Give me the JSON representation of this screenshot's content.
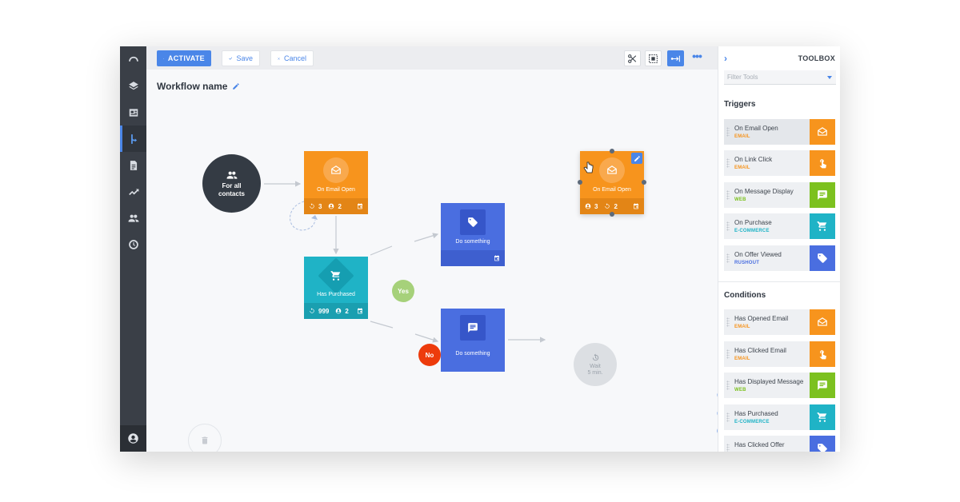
{
  "toolbar": {
    "activate_label": "ACTIVATE",
    "save_label": "Save",
    "cancel_label": "Cancel"
  },
  "workflow": {
    "title": "Workflow name"
  },
  "canvas": {
    "start": {
      "line1": "For all",
      "line2": "contacts"
    },
    "node_email_open": {
      "label": "On Email Open",
      "count_a": "3",
      "count_b": "2"
    },
    "node_email_open_copy": {
      "label": "On Email Open",
      "count_a": "3",
      "count_b": "2"
    },
    "node_purchased": {
      "label": "Has Purchased",
      "count_a": "999",
      "count_b": "2"
    },
    "node_do_something_1": {
      "label": "Do something"
    },
    "node_do_something_2": {
      "label": "Do something"
    },
    "yes_label": "Yes",
    "no_label": "No",
    "wait": {
      "line1": "Wait",
      "line2": "5 min."
    }
  },
  "toolbox": {
    "title": "TOOLBOX",
    "filter_placeholder": "Filter Tools",
    "triggers_heading": "Triggers",
    "conditions_heading": "Conditions",
    "triggers": [
      {
        "name": "On Email Open",
        "type": "EMAIL",
        "color": "#f7941d",
        "icon": "envelope-icon"
      },
      {
        "name": "On Link Click",
        "type": "EMAIL",
        "color": "#f7941d",
        "icon": "pointer-hand-icon"
      },
      {
        "name": "On Message Display",
        "type": "WEB",
        "color": "#7cc11f",
        "icon": "message-icon"
      },
      {
        "name": "On Purchase",
        "type": "E-COMMERCE",
        "color": "#1fb3c6",
        "icon": "cart-icon"
      },
      {
        "name": "On Offer Viewed",
        "type": "RUSHOUT",
        "color": "#4a6ee0",
        "icon": "tag-icon"
      }
    ],
    "conditions": [
      {
        "name": "Has Opened Email",
        "type": "EMAIL",
        "color": "#f7941d",
        "icon": "envelope-icon"
      },
      {
        "name": "Has Clicked Email",
        "type": "EMAIL",
        "color": "#f7941d",
        "icon": "pointer-hand-icon"
      },
      {
        "name": "Has Displayed Message",
        "type": "WEB",
        "color": "#7cc11f",
        "icon": "message-icon"
      },
      {
        "name": "Has Purchased",
        "type": "E-COMMERCE",
        "color": "#1fb3c6",
        "icon": "cart-icon"
      },
      {
        "name": "Has Clicked Offer",
        "type": "",
        "color": "#4a6ee0",
        "icon": "tag-icon"
      }
    ]
  }
}
